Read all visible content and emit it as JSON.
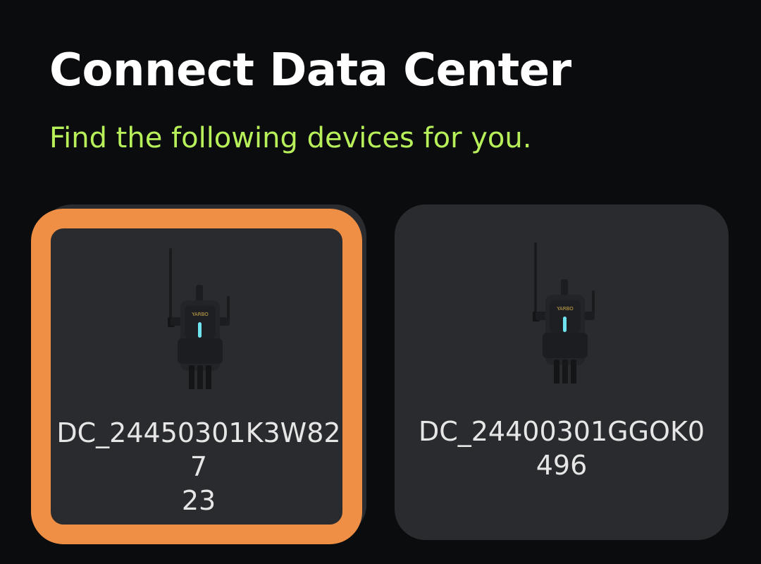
{
  "header": {
    "title": "Connect Data Center",
    "subtitle": "Find the following devices for you."
  },
  "devices": [
    {
      "name": "DC_24450301K3W82723",
      "name_line1": "DC_24450301K3W827",
      "name_line2": "23",
      "selected": true,
      "icon": "data-center-device-icon",
      "brand_label": "YARBO"
    },
    {
      "name": "DC_24400301GGOK0496",
      "name_line1": "DC_24400301GGOK0",
      "name_line2": "496",
      "selected": false,
      "icon": "data-center-device-icon",
      "brand_label": "YARBO"
    }
  ],
  "colors": {
    "background": "#0b0c0e",
    "card": "#2a2b2e",
    "accent_subtitle": "#b8f05a",
    "selection_border": "#ef8f45",
    "device_led": "#6fe3f0"
  }
}
